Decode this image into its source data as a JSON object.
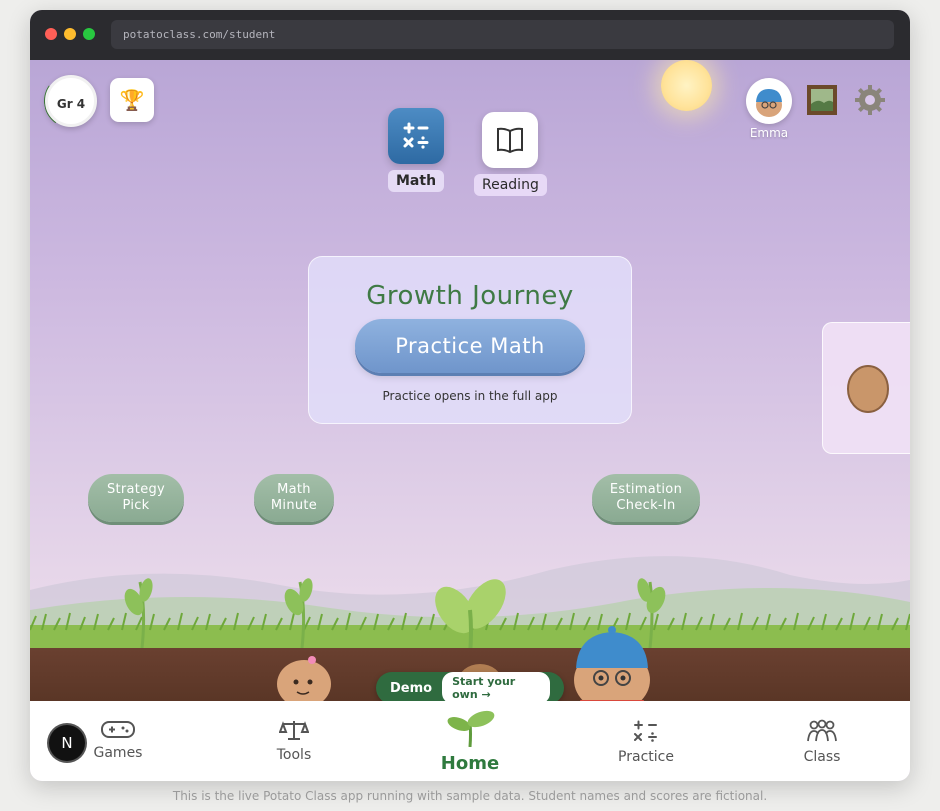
{
  "browser": {
    "url": "potatoclass.com/student"
  },
  "header": {
    "grade_label": "Gr 4",
    "trophy_icon": "trophy-icon",
    "user_name": "Emma"
  },
  "subjects": [
    {
      "label": "Math",
      "icon": "math-operators-icon",
      "selected": true
    },
    {
      "label": "Reading",
      "icon": "book-icon",
      "selected": false
    }
  ],
  "card": {
    "title": "Growth Journey",
    "button": "Practice Math",
    "note": "Practice opens in the full app"
  },
  "activities": [
    {
      "line1": "Strategy",
      "line2": "Pick"
    },
    {
      "line1": "Math",
      "line2": "Minute"
    },
    {
      "line1": "Estimation",
      "line2": "Check-In"
    }
  ],
  "demo": {
    "label": "Demo",
    "button": "Start your own →"
  },
  "nav": {
    "badge": "N",
    "items": [
      {
        "label": "Games",
        "icon": "gamepad-icon"
      },
      {
        "label": "Tools",
        "icon": "scale-icon"
      },
      {
        "label": "Home",
        "icon": "sprout-icon",
        "active": true
      },
      {
        "label": "Practice",
        "icon": "math-operators-icon"
      },
      {
        "label": "Class",
        "icon": "people-icon"
      }
    ]
  },
  "footer": "This is the live Potato Class app running with sample data. Student names and scores are fictional.",
  "colors": {
    "accent_green": "#2f7a3e",
    "title_green": "#3f7a45",
    "practice_blue": "#7b9fd2",
    "sky_purple": "#c4b1db"
  }
}
